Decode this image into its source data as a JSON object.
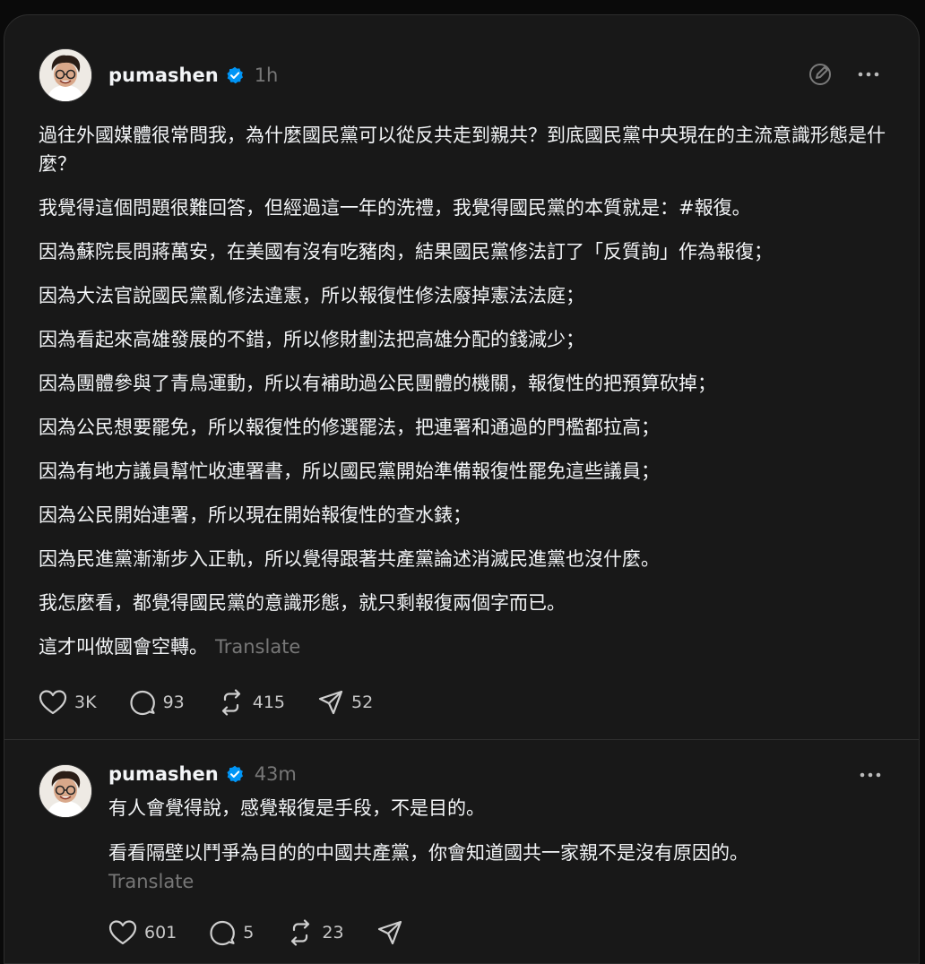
{
  "posts": [
    {
      "username": "pumashen",
      "time": "1h",
      "paragraphs": [
        "過往外國媒體很常問我，為什麼國民黨可以從反共走到親共？到底國民黨中央現在的主流意識形態是什麼？",
        "我覺得這個問題很難回答，但經過這一年的洗禮，我覺得國民黨的本質就是：#報復。",
        "因為蘇院長問蔣萬安，在美國有沒有吃豬肉，結果國民黨修法訂了「反質詢」作為報復；",
        "因為大法官說國民黨亂修法違憲，所以報復性修法廢掉憲法法庭；",
        "因為看起來高雄發展的不錯，所以修財劃法把高雄分配的錢減少；",
        "因為團體參與了青鳥運動，所以有補助過公民團體的機關，報復性的把預算砍掉；",
        "因為公民想要罷免，所以報復性的修選罷法，把連署和通過的門檻都拉高；",
        "因為有地方議員幫忙收連署書，所以國民黨開始準備報復性罷免這些議員；",
        "因為公民開始連署，所以現在開始報復性的查水錶；",
        "因為民進黨漸漸步入正軌，所以覺得跟著共產黨論述消滅民進黨也沒什麼。",
        "我怎麼看，都覺得國民黨的意識形態，就只剩報復兩個字而已。",
        "這才叫做國會空轉。"
      ],
      "translate": "Translate",
      "likes": "3K",
      "replies": "93",
      "reposts": "415",
      "shares": "52"
    },
    {
      "username": "pumashen",
      "time": "43m",
      "paragraphs": [
        "有人會覺得說，感覺報復是手段，不是目的。",
        "看看隔壁以鬥爭為目的的中國共產黨，你會知道國共一家親不是沒有原因的。"
      ],
      "translate": "Translate",
      "likes": "601",
      "replies": "5",
      "reposts": "23",
      "shares": ""
    }
  ],
  "icons": {
    "verified": "verified-badge-icon",
    "edit": "compose-icon",
    "more": "more-icon",
    "like": "heart-icon",
    "reply": "comment-icon",
    "repost": "repost-icon",
    "share": "send-icon"
  },
  "colors": {
    "background": "#0a0a0a",
    "card": "#181818",
    "text": "#f3f5f7",
    "muted": "#777777",
    "verified": "#0095f6"
  }
}
